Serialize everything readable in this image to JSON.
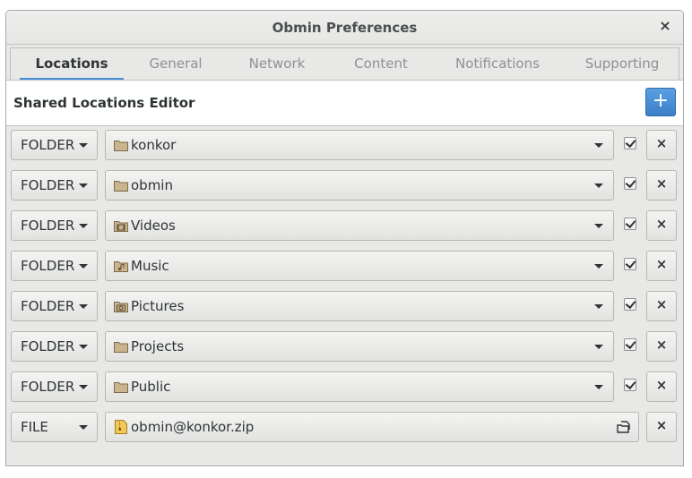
{
  "window": {
    "title": "Obmin Preferences",
    "close_glyph": "×"
  },
  "tabs": [
    {
      "label": "Locations",
      "active": true
    },
    {
      "label": "General"
    },
    {
      "label": "Network"
    },
    {
      "label": "Content"
    },
    {
      "label": "Notifications"
    },
    {
      "label": "Supporting"
    }
  ],
  "panel": {
    "title": "Shared Locations Editor",
    "add_glyph": "+"
  },
  "rows": [
    {
      "type": "FOLDER",
      "location": "konkor",
      "icon": "folder-icon",
      "enabled": true
    },
    {
      "type": "FOLDER",
      "location": "obmin",
      "icon": "folder-icon",
      "enabled": true
    },
    {
      "type": "FOLDER",
      "location": "Videos",
      "icon": "folder-videos-icon",
      "enabled": true
    },
    {
      "type": "FOLDER",
      "location": "Music",
      "icon": "folder-music-icon",
      "enabled": true
    },
    {
      "type": "FOLDER",
      "location": "Pictures",
      "icon": "folder-pictures-icon",
      "enabled": true
    },
    {
      "type": "FOLDER",
      "location": "Projects",
      "icon": "folder-icon",
      "enabled": true
    },
    {
      "type": "FOLDER",
      "location": "Public",
      "icon": "folder-icon",
      "enabled": true
    },
    {
      "type": "FILE",
      "location": "obmin@konkor.zip",
      "icon": "zip-file-icon"
    }
  ],
  "remove_glyph": "×",
  "colors": {
    "accent": "#4a90d9",
    "folder": "#b8a07a"
  }
}
